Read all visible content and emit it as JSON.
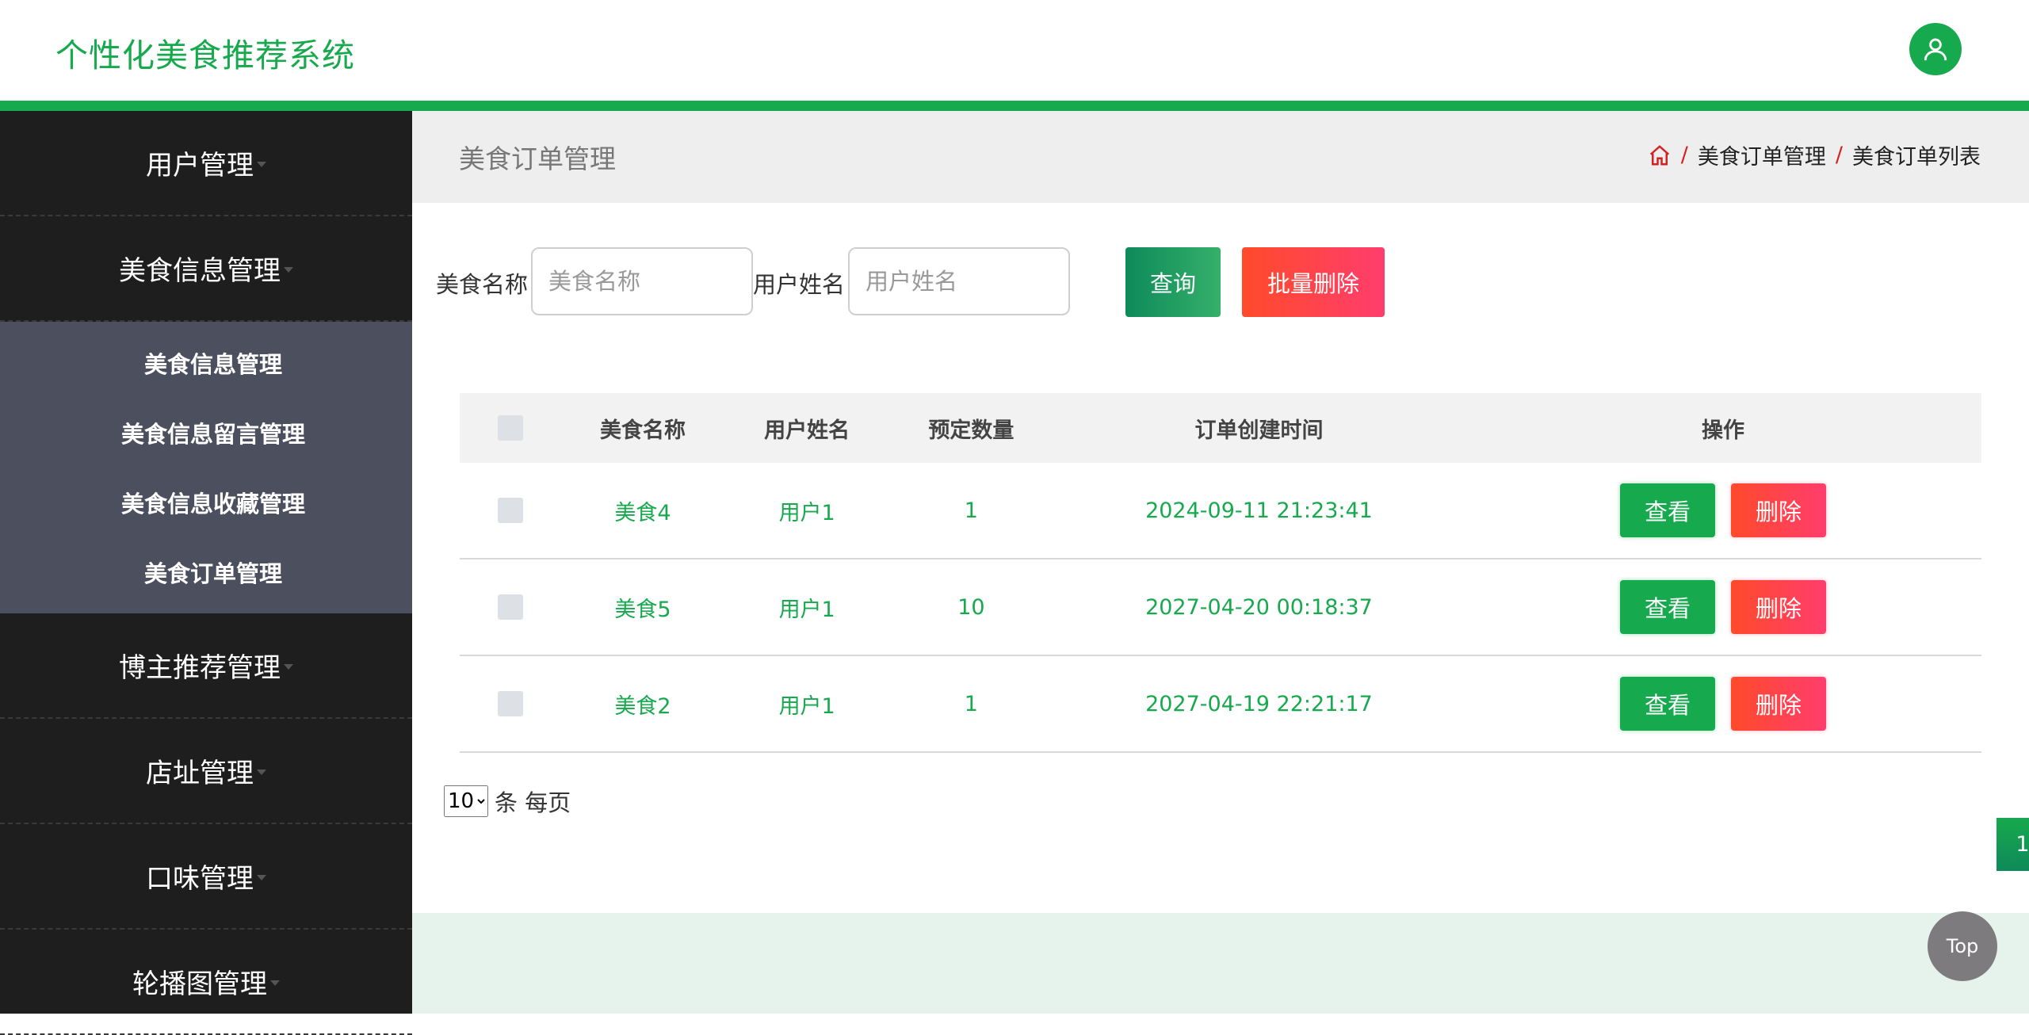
{
  "header": {
    "title": "个性化美食推荐系统",
    "avatar_icon": "user-icon"
  },
  "sidebar": {
    "items": [
      {
        "label": "用户管理"
      },
      {
        "label": "美食信息管理"
      },
      {
        "label": "博主推荐管理"
      },
      {
        "label": "店址管理"
      },
      {
        "label": "口味管理"
      },
      {
        "label": "轮播图管理"
      }
    ],
    "submenu": [
      {
        "label": "美食信息管理"
      },
      {
        "label": "美食信息留言管理"
      },
      {
        "label": "美食信息收藏管理"
      },
      {
        "label": "美食订单管理"
      }
    ]
  },
  "page": {
    "title": "美食订单管理",
    "breadcrumb": [
      "美食订单管理",
      "美食订单列表"
    ],
    "home_icon": "home-icon"
  },
  "search": {
    "food_name_label": "美食名称",
    "food_name_placeholder": "美食名称",
    "user_name_label": "用户姓名",
    "user_name_placeholder": "用户姓名",
    "query_button": "查询",
    "batch_delete_button": "批量删除"
  },
  "table": {
    "columns": [
      "美食名称",
      "用户姓名",
      "预定数量",
      "订单创建时间",
      "操作"
    ],
    "rows": [
      {
        "food": "美食4",
        "user": "用户1",
        "qty": "1",
        "time": "2024-09-11 21:23:41"
      },
      {
        "food": "美食5",
        "user": "用户1",
        "qty": "10",
        "time": "2027-04-20 00:18:37"
      },
      {
        "food": "美食2",
        "user": "用户1",
        "qty": "1",
        "time": "2027-04-19 22:21:17"
      }
    ],
    "view_label": "查看",
    "delete_label": "删除"
  },
  "pagination": {
    "per_page": "10",
    "per_page_suffix": "条 每页",
    "current_page": "1"
  },
  "top_button": "Top",
  "colors": {
    "brand": "#17a94d",
    "danger": "#ff4a4a",
    "sidebar_bg": "#1e1e1e",
    "submenu_bg": "#4b4f5e"
  }
}
